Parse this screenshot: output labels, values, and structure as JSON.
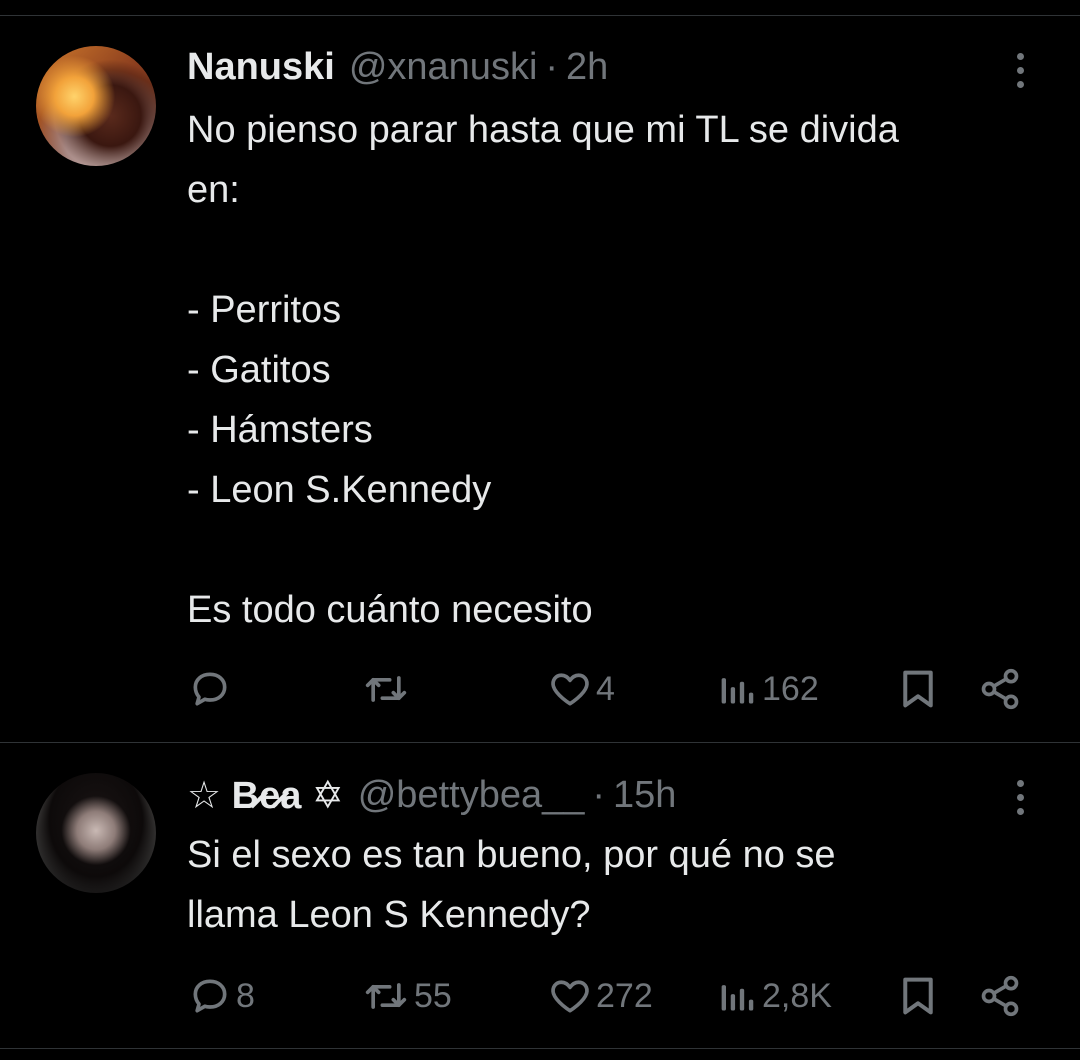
{
  "tweets": [
    {
      "author_name": "Nanuski",
      "handle": "@xnanuski",
      "separator": "·",
      "time": "2h",
      "text_lines": [
        "No pienso parar hasta que mi TL se divida",
        "en:",
        "",
        "- Perritos",
        "- Gatitos",
        "- Hámsters",
        "- Leon S.Kennedy",
        "",
        "Es todo cuánto necesito"
      ],
      "replies": "",
      "retweets": "",
      "likes": "4",
      "views": "162"
    },
    {
      "author_name": "☆ B̷e̷a ✡︎",
      "handle": "@bettybea__",
      "separator": "·",
      "time": "15h",
      "text_lines": [
        "Si el sexo es tan bueno, por qué no se",
        "llama Leon S Kennedy?"
      ],
      "replies": "8",
      "retweets": "55",
      "likes": "272",
      "views": "2,8K"
    }
  ],
  "icons": {
    "reply": "reply-icon",
    "retweet": "retweet-icon",
    "like": "heart-icon",
    "views": "views-icon",
    "bookmark": "bookmark-icon",
    "share": "share-icon",
    "more": "more-icon"
  },
  "colors": {
    "background": "#000000",
    "text": "#e7e9ea",
    "secondary": "#71767b",
    "divider": "#2f3336"
  }
}
